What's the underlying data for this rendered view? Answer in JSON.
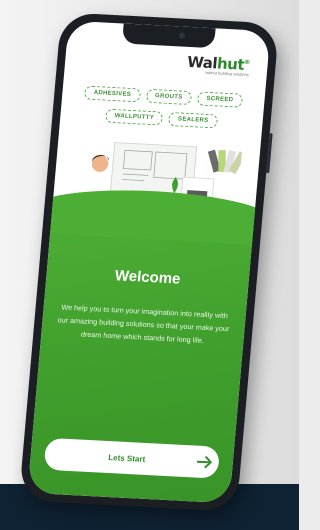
{
  "brand": {
    "name_left": "Wal",
    "name_right": "hut",
    "mark": "®",
    "tagline": "walnut  building  solutions"
  },
  "categories": [
    {
      "label": "ADHESIVES"
    },
    {
      "label": "GROUTS"
    },
    {
      "label": "SCREED"
    },
    {
      "label": "WALLPUTTY"
    },
    {
      "label": "SEALERS"
    }
  ],
  "welcome": {
    "title": "Welcome",
    "text": "We help you to turn your imagination into reality with our amazing building solutions so that your make your dream home which stands for long life."
  },
  "cta": {
    "label": "Lets Start",
    "icon": "arrow-right-icon"
  },
  "colors": {
    "primary_green": "#4dae35",
    "dark_green": "#2f8f28",
    "phone_frame": "#1b1f24",
    "footer_bar": "#0f2233"
  }
}
